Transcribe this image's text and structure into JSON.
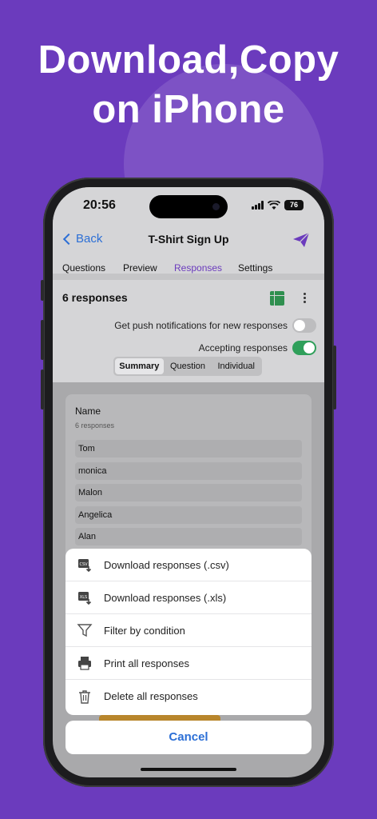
{
  "headline": {
    "line1": "Download,Copy",
    "line2": "on iPhone"
  },
  "status": {
    "time": "20:56",
    "battery": "76"
  },
  "nav": {
    "back_label": "Back",
    "title": "T-Shirt Sign Up"
  },
  "tabs": [
    {
      "label": "Questions"
    },
    {
      "label": "Preview"
    },
    {
      "label": "Responses"
    },
    {
      "label": "Settings"
    }
  ],
  "responses": {
    "count_label": "6 responses",
    "push_label": "Get push notifications for new responses",
    "push_on": false,
    "accepting_label": "Accepting responses",
    "accepting_on": true
  },
  "segments": [
    {
      "label": "Summary"
    },
    {
      "label": "Question"
    },
    {
      "label": "Individual"
    }
  ],
  "name_card": {
    "label": "Name",
    "sub": "6 responses",
    "items": [
      "Tom",
      "monica",
      "Malon",
      "Angelica",
      "Alan"
    ]
  },
  "action_sheet": {
    "items": [
      {
        "label": "Download responses (.csv)",
        "icon": "csv-download-icon"
      },
      {
        "label": "Download responses (.xls)",
        "icon": "xls-download-icon"
      },
      {
        "label": "Filter by condition",
        "icon": "filter-icon"
      },
      {
        "label": "Print all responses",
        "icon": "printer-icon"
      },
      {
        "label": "Delete all responses",
        "icon": "trash-icon"
      }
    ],
    "cancel_label": "Cancel"
  },
  "colors": {
    "background": "#6b3bbd",
    "accent_blue": "#2c6fd6",
    "toggle_green": "#2f9f5a"
  }
}
